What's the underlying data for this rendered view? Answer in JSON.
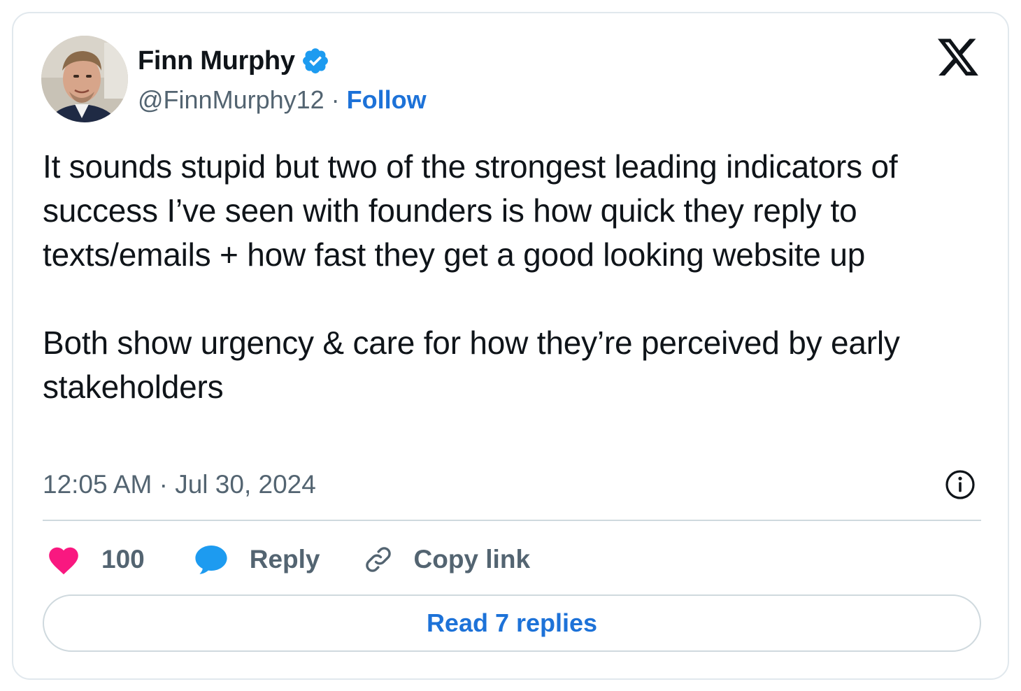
{
  "author": {
    "name": "Finn Murphy",
    "handle": "@FinnMurphy12",
    "separator": "·",
    "follow_label": "Follow"
  },
  "tweet": {
    "paragraphs": [
      "It sounds stupid but two of the strongest leading indicators of success I’ve seen with founders is how quick they reply to texts/emails + how fast they get a good looking website up",
      "Both show urgency & care for how they’re perceived by early stakeholders"
    ],
    "timestamp": "12:05 AM · Jul 30, 2024"
  },
  "actions": {
    "like_count": "100",
    "reply_label": "Reply",
    "copy_link_label": "Copy link"
  },
  "read_replies_label": "Read 7 replies",
  "icons": {
    "brand": "x-logo-icon",
    "verified": "verified-badge-icon",
    "info": "info-icon",
    "like": "heart-icon",
    "reply": "speech-bubble-icon",
    "copy_link": "link-icon"
  },
  "colors": {
    "accent": "#1d72d8",
    "verified": "#1d9bf0",
    "like": "#f91880",
    "secondary_text": "#536471",
    "border": "#cfd9de"
  }
}
